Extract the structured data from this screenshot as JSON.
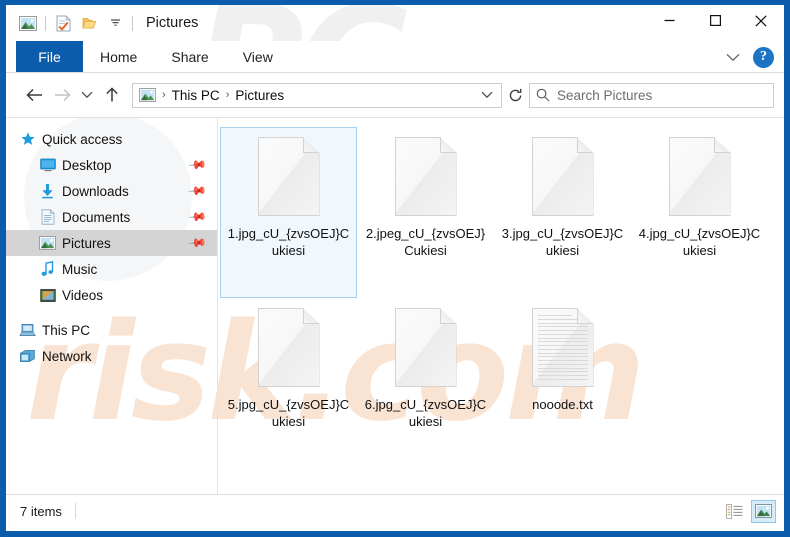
{
  "window": {
    "title": "Pictures",
    "frame_color": "#0b5cab",
    "quick_access_icons": [
      "picture-icon",
      "properties-icon",
      "new-folder-icon",
      "customize-chevron-icon"
    ],
    "controls": {
      "minimize": "—",
      "maximize": "☐",
      "close": "✕"
    }
  },
  "ribbon": {
    "tabs": [
      {
        "label": "File",
        "active": true
      },
      {
        "label": "Home",
        "active": false
      },
      {
        "label": "Share",
        "active": false
      },
      {
        "label": "View",
        "active": false
      }
    ],
    "collapse_icon": "∨",
    "help_label": "?"
  },
  "address": {
    "back_icon": "←",
    "forward_icon": "→",
    "recent_icon": "∨",
    "up_icon": "↑",
    "breadcrumb": [
      "This PC",
      "Pictures"
    ],
    "separator": "›",
    "dropdown_icon": "∨",
    "refresh_icon": "↻"
  },
  "search": {
    "placeholder": "Search Pictures",
    "value": "",
    "icon": "search-icon"
  },
  "sidebar": {
    "items": [
      {
        "label": "Quick access",
        "icon": "star-icon",
        "level": 0,
        "pinned": false,
        "selected": false
      },
      {
        "label": "Desktop",
        "icon": "desktop-icon",
        "level": 1,
        "pinned": true,
        "selected": false
      },
      {
        "label": "Downloads",
        "icon": "download-icon",
        "level": 1,
        "pinned": true,
        "selected": false
      },
      {
        "label": "Documents",
        "icon": "documents-icon",
        "level": 1,
        "pinned": true,
        "selected": false
      },
      {
        "label": "Pictures",
        "icon": "picture-icon",
        "level": 1,
        "pinned": true,
        "selected": true
      },
      {
        "label": "Music",
        "icon": "music-icon",
        "level": 1,
        "pinned": false,
        "selected": false
      },
      {
        "label": "Videos",
        "icon": "video-icon",
        "level": 1,
        "pinned": false,
        "selected": false
      },
      {
        "label": "This PC",
        "icon": "computer-icon",
        "level": 0,
        "pinned": false,
        "selected": false
      },
      {
        "label": "Network",
        "icon": "network-icon",
        "level": 0,
        "pinned": false,
        "selected": false
      }
    ]
  },
  "files": [
    {
      "name": "1.jpg_cU_{zvsOEJ}Cukiesi",
      "type": "blank",
      "selected": true
    },
    {
      "name": "2.jpeg_cU_{zvsOEJ}Cukiesi",
      "type": "blank",
      "selected": false
    },
    {
      "name": "3.jpg_cU_{zvsOEJ}Cukiesi",
      "type": "blank",
      "selected": false
    },
    {
      "name": "4.jpg_cU_{zvsOEJ}Cukiesi",
      "type": "blank",
      "selected": false
    },
    {
      "name": "5.jpg_cU_{zvsOEJ}Cukiesi",
      "type": "blank",
      "selected": false
    },
    {
      "name": "6.jpg_cU_{zvsOEJ}Cukiesi",
      "type": "blank",
      "selected": false
    },
    {
      "name": "nooode.txt",
      "type": "text",
      "selected": false
    }
  ],
  "status": {
    "item_count": "7 items",
    "views": [
      {
        "name": "details-view",
        "active": false
      },
      {
        "name": "large-icons-view",
        "active": true
      }
    ]
  },
  "watermark": {
    "top_text": "PC",
    "bottom_text": "risk.com"
  }
}
